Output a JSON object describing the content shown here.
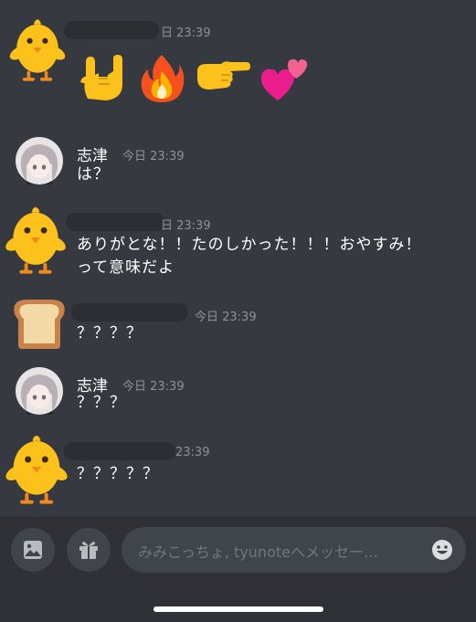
{
  "messages": [
    {
      "type": "emoji_only",
      "timestamp": "日 23:39",
      "avatar_icon": "chick-icon",
      "emojis": [
        "sign-of-horns-icon",
        "fire-icon",
        "pointing-right-icon",
        "two-hearts-icon"
      ]
    },
    {
      "author": "志津",
      "timestamp": "今日 23:39",
      "avatar_icon": "anime-girl-avatar",
      "text": "は？"
    },
    {
      "timestamp": "日 23:39",
      "avatar_icon": "chick-icon",
      "text_lines": [
        "ありがとな！！たのしかった！！！おやすみ！",
        "って意味だよ"
      ]
    },
    {
      "timestamp": "今日 23:39",
      "avatar_icon": "bread-icon",
      "text": "？？？？"
    },
    {
      "author": "志津",
      "timestamp": "今日 23:39",
      "avatar_icon": "anime-girl-avatar",
      "text": "？？？"
    },
    {
      "timestamp": "23:39",
      "avatar_icon": "chick-icon",
      "text": "？？？？？"
    }
  ],
  "composer": {
    "placeholder": "みみこっちょ, tyunoteへメッセー…",
    "buttons": [
      "image-icon",
      "gift-icon",
      "emoji-icon"
    ]
  },
  "colors": {
    "background": "#36393f",
    "composer_bar": "#2f3136",
    "input": "#40444b",
    "timestamp": "#8e9297"
  }
}
